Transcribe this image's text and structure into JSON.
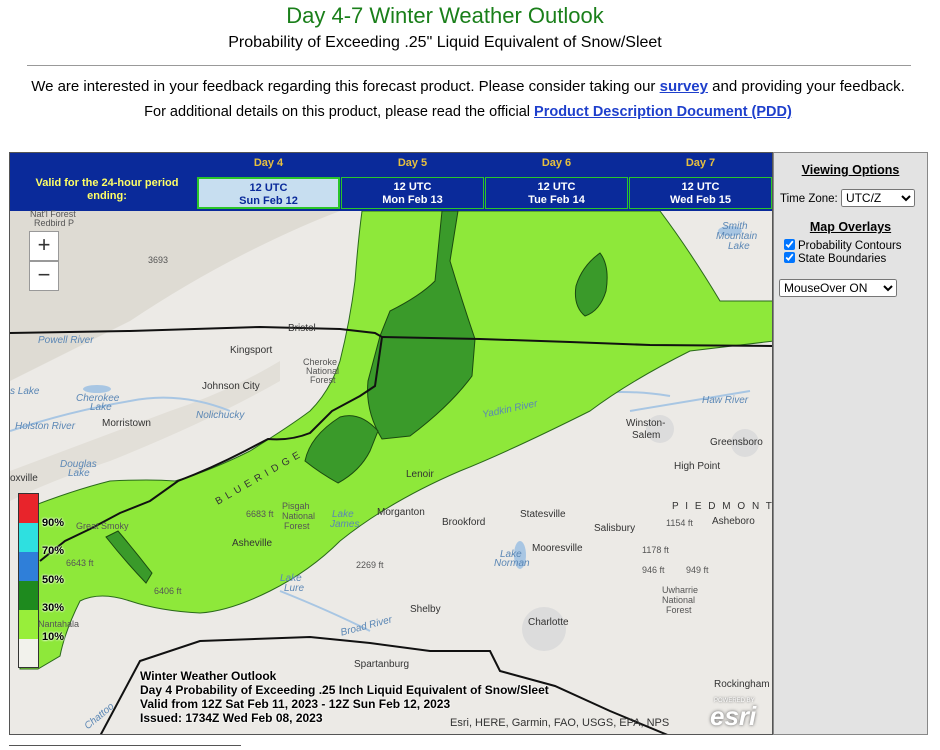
{
  "header": {
    "title": "Day 4-7 Winter Weather Outlook",
    "subtitle": "Probability of Exceeding .25\" Liquid Equivalent of Snow/Sleet"
  },
  "feedback": {
    "prefix": "We are interested in your feedback regarding this forecast product. Please consider taking our",
    "survey_link": "survey",
    "suffix": "and providing your feedback.",
    "pdd_prefix": "For additional details on this product, please read the official",
    "pdd_link": "Product Description Document (PDD)"
  },
  "day_selector": {
    "valid_label": "Valid for the 24-hour period ending:",
    "days": [
      {
        "name": "Day 4",
        "time": "12 UTC",
        "date": "Sun Feb 12",
        "selected": true
      },
      {
        "name": "Day 5",
        "time": "12 UTC",
        "date": "Mon Feb 13",
        "selected": false
      },
      {
        "name": "Day 6",
        "time": "12 UTC",
        "date": "Tue Feb 14",
        "selected": false
      },
      {
        "name": "Day 7",
        "time": "12 UTC",
        "date": "Wed Feb 15",
        "selected": false
      }
    ]
  },
  "map": {
    "zoom_in": "+",
    "zoom_out": "−",
    "legend": {
      "levels": [
        "90%",
        "70%",
        "50%",
        "30%",
        "10%"
      ],
      "colors": [
        "#e8242b",
        "#2ee0e0",
        "#2f7fd9",
        "#1e8a1e",
        "#98ee3a"
      ]
    },
    "contour_colors": {
      "p10": "#8ee83a",
      "p30": "#3a9a2a",
      "p50": "#2a8a2a"
    },
    "labels": {
      "bristol": "Bristol",
      "kingsport": "Kingsport",
      "johnson_city": "Johnson City",
      "morristown": "Morristown",
      "knoxville": "oxville",
      "asheville": "Asheville",
      "morganton": "Morganton",
      "lenoir": "Lenoir",
      "brookford": "Brookford",
      "statesville": "Statesville",
      "salisbury": "Salisbury",
      "mooresville": "Mooresville",
      "shelby": "Shelby",
      "charlotte": "Charlotte",
      "winston_salem_1": "Winston-",
      "winston_salem_2": "Salem",
      "greensboro": "Greensboro",
      "high_point": "High Point",
      "asheboro": "Asheboro",
      "piedmont": "P I E D M O N T",
      "spartanburg": "Spartanburg",
      "rockingham": "Rockingham",
      "natl_forest": "Nat'l Forest",
      "redbird": "Redbird P",
      "cherokee_nf_1": "Cheroke",
      "cherokee_nf_2": "National",
      "cherokee_nf_3": "Forest",
      "pisgah_1": "Pisgah",
      "pisgah_2": "National",
      "pisgah_3": "Forest",
      "uwharrie_1": "Uwharrie",
      "uwharrie_2": "National",
      "uwharrie_3": "Forest",
      "cherokee_lake_1": "Cherokee",
      "cherokee_lake_2": "Lake",
      "douglas_lake_1": "Douglas",
      "douglas_lake_2": "Lake",
      "smith_mt_1": "Smith",
      "smith_mt_2": "Mountain",
      "smith_mt_3": "Lake",
      "lake_norman_1": "Lake",
      "lake_norman_2": "Norman",
      "lake_lure_1": "Lake",
      "lake_lure_2": "Lure",
      "lake_james_1": "Lake",
      "lake_james_2": "James",
      "yadkin_river": "Yadkin River",
      "haw_river": "Haw River",
      "broad_river": "Broad River",
      "holston_river": "Holston River",
      "nolichucky": "Nolichucky",
      "blue_ridge": "B L U E   R I D G E",
      "powell_river": "Powell River",
      "s_lake": "s Lake",
      "great_smoky_1": "Great Smoky",
      "nantahala": "Nantahala",
      "elev_3693": "3693",
      "elev_6683": "6683 ft",
      "elev_6643": "6643 ft",
      "elev_6406": "6406 ft",
      "elev_2269": "2269 ft",
      "elev_1154": "1154 ft",
      "elev_1178": "1178 ft",
      "elev_946": "946 ft",
      "elev_949": "949 ft",
      "chattooga": "Chattoo"
    },
    "info": {
      "line1": "Winter Weather Outlook",
      "line2": "Day 4 Probability of Exceeding .25 Inch Liquid Equivalent of Snow/Sleet",
      "line3": "Valid from 12Z Sat Feb 11, 2023 - 12Z Sun Feb 12, 2023",
      "line4": "Issued: 1734Z Wed Feb 08, 2023"
    },
    "attribution": "Esri, HERE, Garmin, FAO, USGS, EPA, NPS",
    "powered_by": "POWERED BY",
    "esri_logo": "esri"
  },
  "panel": {
    "viewing_options": "Viewing Options",
    "timezone_label": "Time Zone:",
    "timezone_value": "UTC/Z",
    "map_overlays": "Map Overlays",
    "prob_contours": "Probability Contours",
    "state_boundaries": "State Boundaries",
    "mouseover_value": "MouseOver ON"
  }
}
